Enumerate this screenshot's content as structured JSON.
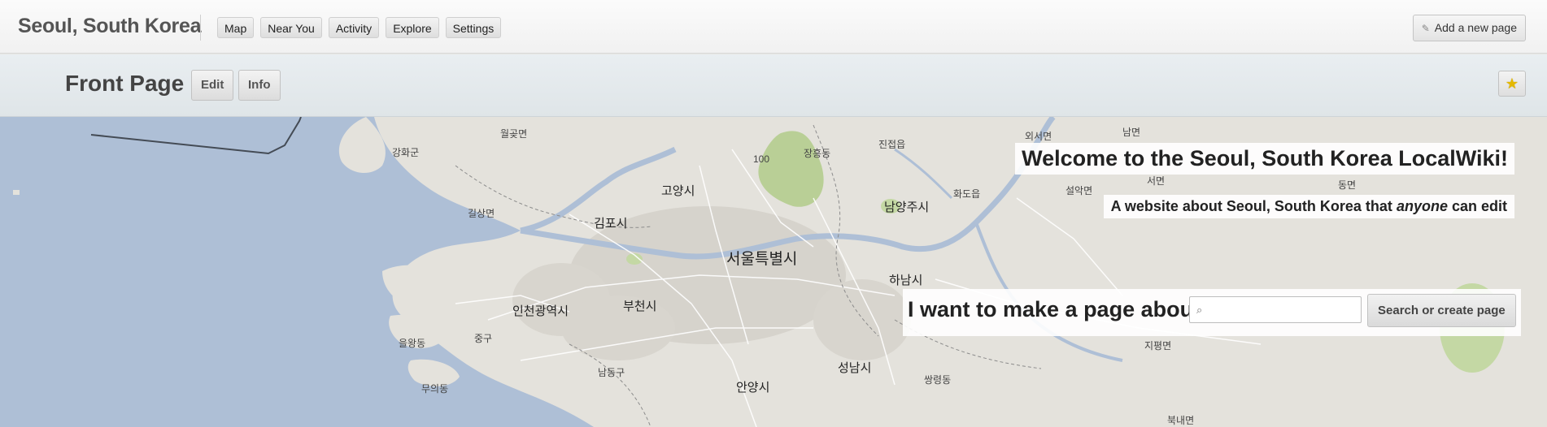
{
  "site": {
    "title": "Seoul, South Korea"
  },
  "nav": {
    "items": [
      "Map",
      "Near You",
      "Activity",
      "Explore",
      "Settings"
    ]
  },
  "header_actions": {
    "add_page_label": "Add a new page",
    "add_page_icon": "pencil-icon"
  },
  "page": {
    "title": "Front Page",
    "edit_label": "Edit",
    "info_label": "Info",
    "star_icon": "star-icon",
    "star_symbol": "★"
  },
  "welcome": {
    "heading": "Welcome to the Seoul, South Korea LocalWiki!",
    "tagline_before": "A website about Seoul, South Korea that ",
    "tagline_emphasis": "anyone",
    "tagline_after": " can edit"
  },
  "make_page": {
    "label": "I want to make a page about",
    "search_icon": "⌕",
    "search_placeholder": "",
    "search_value": "",
    "button_label": "Search or create page"
  },
  "map": {
    "places": {
      "seoul": "서울특별시",
      "incheon": "인천광역시",
      "bucheon": "부천시",
      "goyang": "고양시",
      "gimpo": "김포시",
      "namyangju": "남양주시",
      "hanam": "하남시",
      "seongnam": "성남시",
      "anyang": "안양시",
      "gwolgot": "월곶면",
      "ganghwa": "강화군",
      "gilsang": "길상면",
      "janghung": "장흥동",
      "jinjeop": "진접읍",
      "hwado": "화도읍",
      "oeseo": "외서면",
      "nam": "남면",
      "seorak": "설악면",
      "seo": "서면",
      "dong": "동면",
      "ulwang": "을왕동",
      "junggu": "중구",
      "muui": "무의동",
      "namdong": "남동구",
      "jipyeong": "지평면",
      "ssangryeong": "쌍령동",
      "route100": "100",
      "buknae": "북내면"
    },
    "colors": {
      "water": "#aebfd6",
      "land": "#e4e2dc",
      "park": "#b9cf96",
      "urban": "#d6d3cc"
    }
  }
}
